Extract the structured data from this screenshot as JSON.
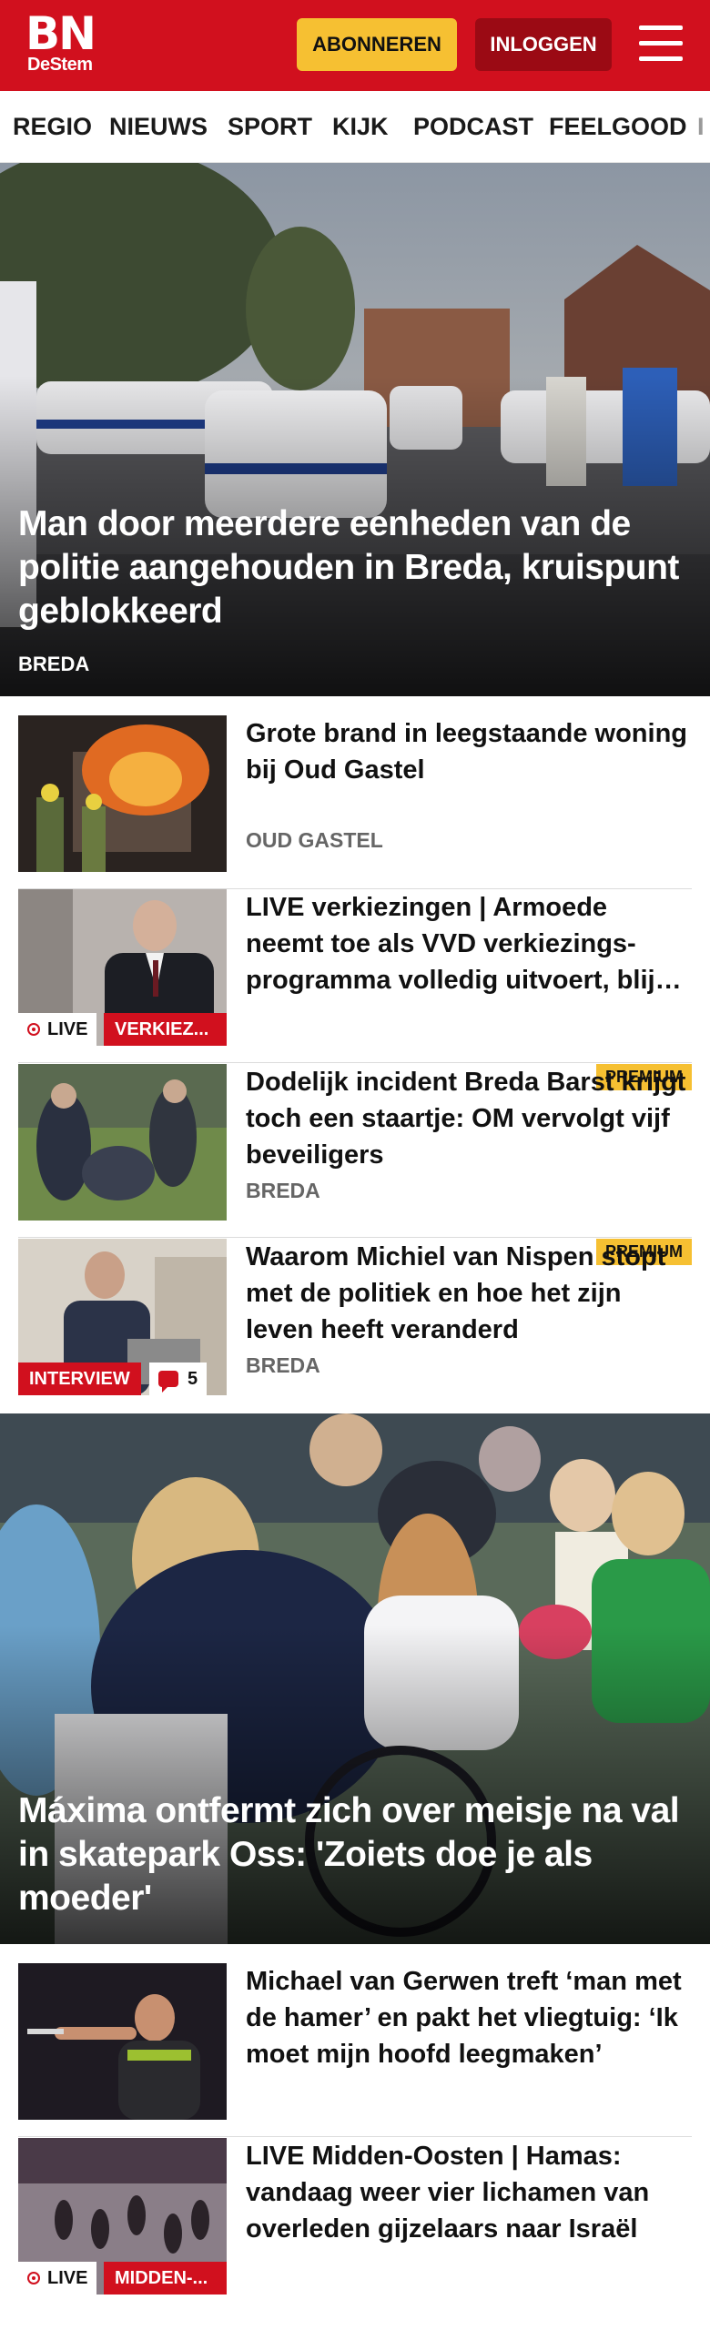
{
  "header": {
    "logo_main": "BN",
    "logo_sub": "DeStem",
    "subscribe_label": "ABONNEREN",
    "login_label": "INLOGGEN",
    "menu_icon": "hamburger-menu-icon"
  },
  "nav": {
    "items": [
      "REGIO",
      "NIEUWS",
      "SPORT",
      "KIJK",
      "PODCAST",
      "FEELGOOD",
      "I"
    ]
  },
  "hero1": {
    "headline": "Man door meerdere eenheden van de politie aangehouden in Breda, kruispunt geblokkeerd",
    "location": "BREDA"
  },
  "articles": [
    {
      "title": "Grote brand in leegstaande woning bij Oud Gastel",
      "location": "OUD GASTEL"
    },
    {
      "title": "LIVE verkiezingen | Armoede neemt toe als VVD verkiezings-programma volledig uitvoert, blijkt uit doorrekening",
      "live_label": "LIVE",
      "tag": "VERKIEZ..."
    },
    {
      "title": "Dodelijk incident Breda Barst krijgt toch een staartje: OM vervolgt vijf beveiligers",
      "location": "BREDA",
      "premium": "PREMIUM"
    },
    {
      "title": "Waarom Michiel van Nispen stopt met de politiek en hoe het zijn leven heeft veranderd",
      "location": "BREDA",
      "premium": "PREMIUM",
      "tag": "INTERVIEW",
      "comments": "5"
    }
  ],
  "hero2": {
    "headline": "Máxima ontfermt zich over meisje na val in skatepark Oss: 'Zoiets doe je als moeder'"
  },
  "articles2": [
    {
      "title": "Michael van Gerwen treft ‘man met de hamer’ en pakt het vliegtuig: ‘Ik moet mijn hoofd leegmaken’"
    },
    {
      "title": "LIVE Midden-Oosten | Hamas: vandaag weer vier lichamen van overleden gijzelaars naar Israël",
      "live_label": "LIVE",
      "tag": "MIDDEN-..."
    }
  ]
}
